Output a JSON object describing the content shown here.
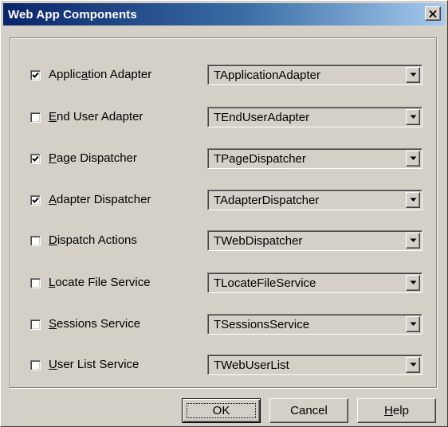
{
  "window": {
    "title": "Web App Components",
    "close_label": "x"
  },
  "components": [
    {
      "pre": "Applic",
      "acc": "a",
      "post": "tion Adapter",
      "checked": true,
      "value": "TApplicationAdapter"
    },
    {
      "pre": "",
      "acc": "E",
      "post": "nd User Adapter",
      "checked": false,
      "value": "TEndUserAdapter"
    },
    {
      "pre": "",
      "acc": "P",
      "post": "age Dispatcher",
      "checked": true,
      "value": "TPageDispatcher"
    },
    {
      "pre": "",
      "acc": "A",
      "post": "dapter Dispatcher",
      "checked": true,
      "value": "TAdapterDispatcher"
    },
    {
      "pre": "",
      "acc": "D",
      "post": "ispatch Actions",
      "checked": false,
      "value": "TWebDispatcher"
    },
    {
      "pre": "",
      "acc": "L",
      "post": "ocate File Service",
      "checked": false,
      "value": "TLocateFileService"
    },
    {
      "pre": "",
      "acc": "S",
      "post": "essions Service",
      "checked": false,
      "value": "TSessionsService"
    },
    {
      "pre": "",
      "acc": "U",
      "post": "ser List Service",
      "checked": false,
      "value": "TWebUserList"
    }
  ],
  "buttons": {
    "ok": "OK",
    "cancel": "Cancel",
    "help_acc": "H",
    "help_rest": "elp"
  },
  "icons": {
    "check": "check-icon",
    "dropdown": "chevron-down-icon",
    "close": "close-icon"
  }
}
